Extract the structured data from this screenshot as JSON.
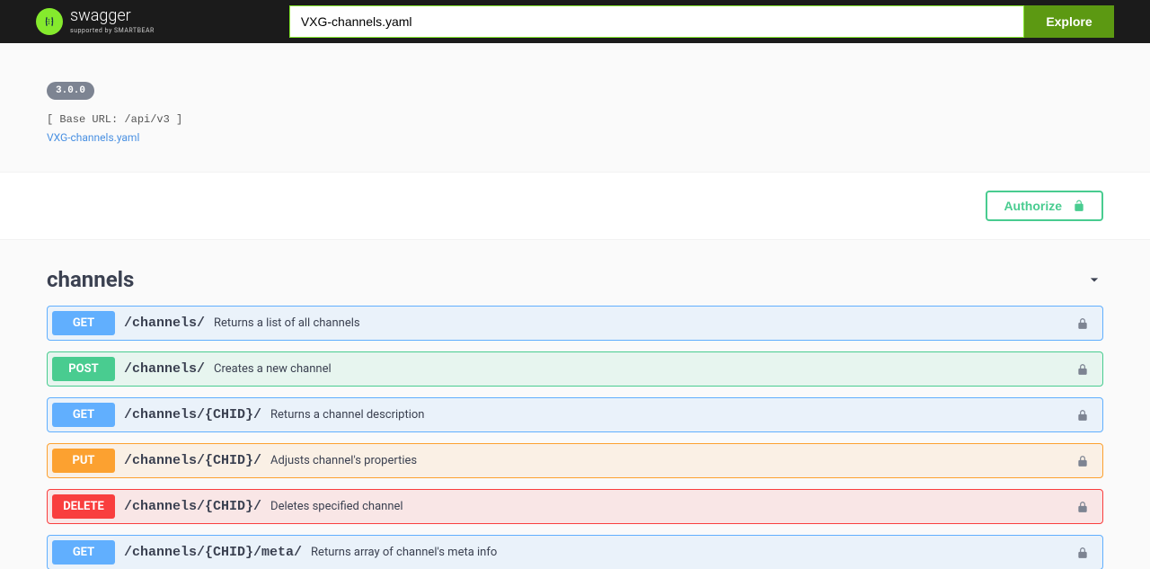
{
  "topbar": {
    "logo_text": "swagger",
    "logo_subtext": "supported by SMARTBEAR",
    "input_value": "VXG-channels.yaml",
    "explore_label": "Explore"
  },
  "info": {
    "oas_version": "3.0.0",
    "base_url_label": "[ Base URL: /api/v3 ]",
    "spec_link": "VXG-channels.yaml"
  },
  "auth": {
    "authorize_label": "Authorize"
  },
  "tag": {
    "name": "channels"
  },
  "operations": [
    {
      "method": "GET",
      "class": "get",
      "path": "/channels/",
      "description": "Returns a list of all channels"
    },
    {
      "method": "POST",
      "class": "post",
      "path": "/channels/",
      "description": "Creates a new channel"
    },
    {
      "method": "GET",
      "class": "get",
      "path": "/channels/{CHID}/",
      "description": "Returns a channel description"
    },
    {
      "method": "PUT",
      "class": "put",
      "path": "/channels/{CHID}/",
      "description": "Adjusts channel's properties"
    },
    {
      "method": "DELETE",
      "class": "delete",
      "path": "/channels/{CHID}/",
      "description": "Deletes specified channel"
    },
    {
      "method": "GET",
      "class": "get",
      "path": "/channels/{CHID}/meta/",
      "description": "Returns array of channel's meta info"
    }
  ]
}
